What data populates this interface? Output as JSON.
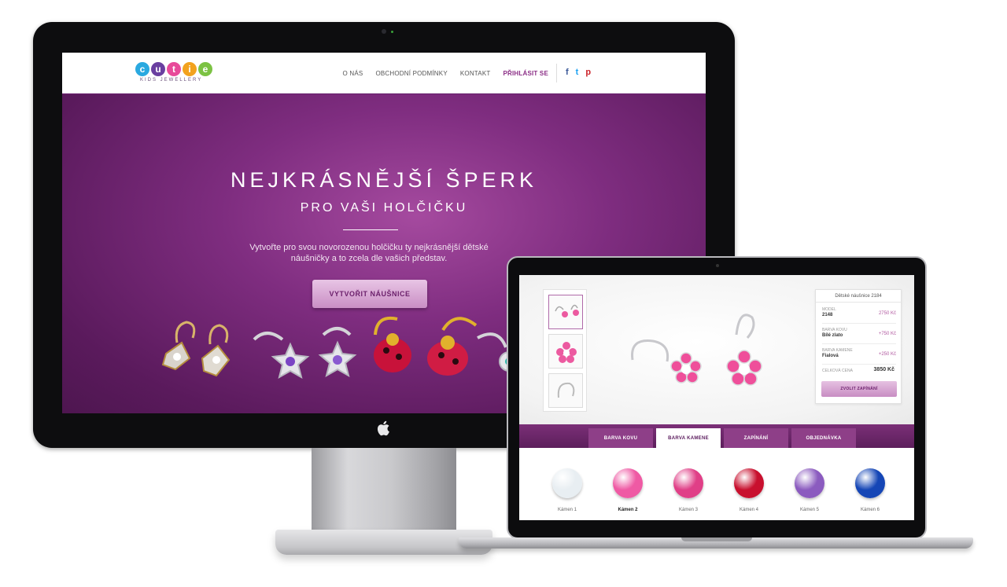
{
  "desktop": {
    "logo": {
      "letters": [
        "c",
        "u",
        "t",
        "i",
        "e"
      ],
      "colors": [
        "#2aa9e0",
        "#6a3fa0",
        "#e84a9a",
        "#f2a21e",
        "#7cc243"
      ],
      "subtitle": "KIDS JEWELLERY"
    },
    "nav": {
      "items": [
        "O NÁS",
        "OBCHODNÍ PODMÍNKY",
        "KONTAKT"
      ],
      "login": "PŘIHLÁSIT SE"
    },
    "social": [
      {
        "icon": "facebook-icon",
        "glyph": "f",
        "color": "#3b5998"
      },
      {
        "icon": "twitter-icon",
        "glyph": "t",
        "color": "#1da1f2"
      },
      {
        "icon": "pinterest-icon",
        "glyph": "p",
        "color": "#cb2027"
      }
    ],
    "hero": {
      "title": "NEJKRÁSNĚJŠÍ ŠPERK",
      "subtitle": "PRO VAŠI HOLČIČKU",
      "text": "Vytvořte pro svou novorozenou holčičku ty nejkrásnější dětské náušničky a to zcela dle vašich představ.",
      "cta": "VYTVOŘIT NÁUŠNICE"
    }
  },
  "laptop": {
    "panel": {
      "title": "Dětské náušnice 2184",
      "rows": [
        {
          "label": "MODEL",
          "value": "2148",
          "price": "2750 Kč"
        },
        {
          "label": "BARVA KOVU",
          "value": "Bílé zlato",
          "price": "+750 Kč"
        },
        {
          "label": "BARVA KAMENE",
          "value": "Fialová",
          "price": "+250 Kč"
        }
      ],
      "total_label": "CELKOVÁ CENA",
      "total_value": "3850 Kč",
      "button": "ZVOLIT ZAPÍNÁNÍ"
    },
    "tabs": [
      "BARVA KOVU",
      "BARVA KAMENE",
      "ZAPÍNÁNÍ",
      "OBJEDNÁVKA"
    ],
    "active_tab": 1,
    "stones": [
      {
        "label": "Kámen 1",
        "color": "#e8eef2"
      },
      {
        "label": "Kámen 2",
        "color": "#ef5aa4"
      },
      {
        "label": "Kámen 3",
        "color": "#e03f87"
      },
      {
        "label": "Kámen 4",
        "color": "#c8102e"
      },
      {
        "label": "Kámen 5",
        "color": "#8b5bbf"
      },
      {
        "label": "Kámen 6",
        "color": "#1546b6"
      }
    ],
    "active_stone": 1
  }
}
